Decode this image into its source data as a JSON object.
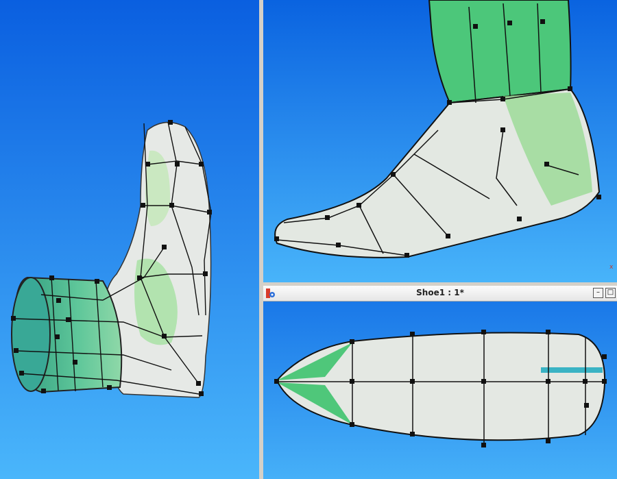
{
  "colors": {
    "viewport_gradient_top": "#0a63e0",
    "viewport_gradient_bottom": "#49b4fa",
    "mesh_green": "#3fc37a",
    "mesh_white": "#e8ece8",
    "control_point": "#111111",
    "accent_cyan": "#3ab3c4"
  },
  "subwindow": {
    "title": "Shoe1 : 1*",
    "app_icon": "app-gear-icon",
    "minimize_label": "–",
    "maximize_label": "□"
  },
  "viewports": {
    "left": {
      "view": "left-3d-view",
      "object": "shoe-last-mesh"
    },
    "top_right": {
      "view": "side-view",
      "object": "shoe-last-mesh"
    },
    "bottom_right": {
      "view": "top-view",
      "object": "shoe-last-mesh"
    }
  },
  "axis_marker": {
    "label": "x"
  }
}
